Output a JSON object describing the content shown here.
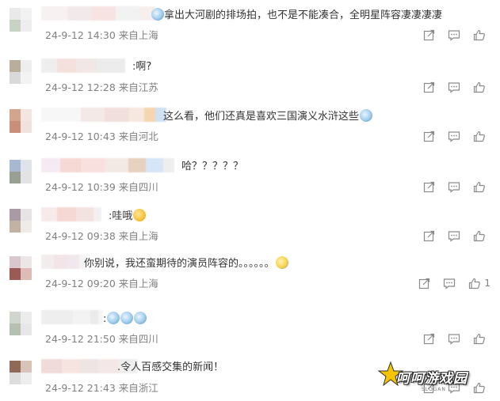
{
  "comments": [
    {
      "text": "拿出大河剧的排场拍，也不是不能凑合，全明星阵容凄凄凄凄",
      "emoji_before": "em-face",
      "emoji_after": "",
      "time": "24-9-12 14:30",
      "location": "来自上海",
      "likes": "",
      "avatar_colors": [
        "#e9e9e9",
        "#f2f2f2",
        "#c9d3c5",
        "#eeeeee"
      ],
      "name_colors": [
        "#f7f1f1",
        "#f1e9ea",
        "#f6e3e2",
        "#f2f2f2",
        "#f7eeee"
      ]
    },
    {
      "text": ":啊?",
      "emoji_before": "",
      "emoji_after": "",
      "time": "24-9-12 12:28",
      "location": "来自江苏",
      "likes": "",
      "avatar_colors": [
        "#b9ad9c",
        "#eeeeee",
        "#d9d9d9",
        "#f3f3f3"
      ],
      "name_colors": [
        "#eeeeee",
        "#f4e1dd",
        "#f0e7e6",
        "#ececec"
      ]
    },
    {
      "text": "这么看，他们还真是喜欢三国演义水浒这些",
      "emoji_before": "",
      "emoji_after": "em-face",
      "time": "24-9-12 10:43",
      "location": "来自河北",
      "likes": "",
      "avatar_colors": [
        "#d3a48e",
        "#f4e5e1",
        "#c98f7a",
        "#f1e2dd"
      ],
      "name_colors": [
        "#f7f7f7",
        "#f3e9e7",
        "#f0dfdc",
        "#f6e8df",
        "#f5d6b1",
        "#cfe2f3"
      ]
    },
    {
      "text": "哈？？？？？",
      "emoji_before": "",
      "emoji_after": "",
      "time": "24-9-12 10:39",
      "location": "来自四川",
      "likes": "",
      "avatar_colors": [
        "#a8b7d2",
        "#dfe3ea",
        "#9a9f94",
        "#e3e3e3"
      ],
      "name_colors": [
        "#f4ecf2",
        "#f6d9d5",
        "#f7e0de",
        "#f2e8e4",
        "#e6d2bf",
        "#d7e6f6",
        "#eeeeee"
      ]
    },
    {
      "text": ":哇哦",
      "emoji_before": "",
      "emoji_after": "em-wow",
      "time": "24-9-12 09:38",
      "location": "来自上海",
      "likes": "",
      "avatar_colors": [
        "#a99aa6",
        "#e8e3e5",
        "#c1b2a4",
        "#efebe7"
      ],
      "name_colors": [
        "#f7eaea",
        "#f5d8d3",
        "#f3e3e0",
        "#f1f1f1"
      ]
    },
    {
      "text": "你别说，我还蛮期待的演员阵容的。。。。。。",
      "emoji_before": "",
      "emoji_after": "em-laugh",
      "time": "24-9-12 09:20",
      "location": "来自上海",
      "likes": "1",
      "avatar_colors": [
        "#d8c7cf",
        "#ece6e7",
        "#9a5a55",
        "#dcbcb4"
      ],
      "name_colors": [
        "#f3ecec",
        "#f2e4e7",
        "#f0e8ec",
        "#f4f4f4"
      ]
    },
    {
      "text": ":",
      "emoji_before": "",
      "emoji_after": "em-face em-face em-face",
      "time": "24-9-12 21:50",
      "location": "来自四川",
      "likes": "",
      "avatar_colors": [
        "#d0d6cd",
        "#ececec",
        "#b5c0b3",
        "#e7e7e7"
      ],
      "name_colors": [
        "#eeeeee",
        "#f3f3f3",
        "#ebebeb",
        "#f5f5f5"
      ]
    },
    {
      "text": ".令人百感交集的新闻！",
      "emoji_before": "",
      "emoji_after": "",
      "time": "24-9-12 21:43",
      "location": "来自浙江",
      "likes": "",
      "avatar_colors": [
        "#8f6a59",
        "#d8c3b8",
        "#dddddd",
        "#eeeeee"
      ],
      "name_colors": [
        "#f0dada",
        "#f6e4e1",
        "#efe4e4",
        "#f3e7e7",
        "#efefef"
      ]
    }
  ],
  "watermark": {
    "title": "呵呵游戏园",
    "subtitle": "SLOGAN"
  },
  "icons": {
    "share": "share-icon",
    "comment": "comment-icon",
    "like": "like-icon"
  }
}
